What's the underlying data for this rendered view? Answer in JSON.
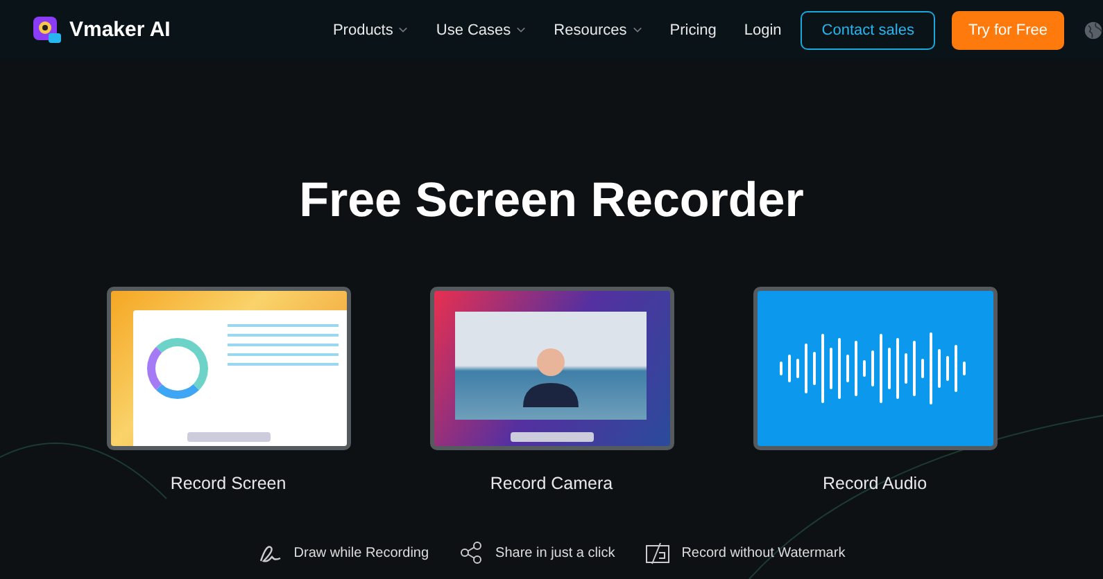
{
  "brand": {
    "name": "Vmaker AI"
  },
  "nav": [
    {
      "label": "Products",
      "has_menu": true
    },
    {
      "label": "Use Cases",
      "has_menu": true
    },
    {
      "label": "Resources",
      "has_menu": true
    },
    {
      "label": "Pricing",
      "has_menu": false
    },
    {
      "label": "Login",
      "has_menu": false
    }
  ],
  "buttons": [
    {
      "label": "Contact sales",
      "kind": "outline"
    },
    {
      "label": "Try for Free",
      "kind": "primary"
    }
  ],
  "heading": "Free Screen Recorder",
  "cards": [
    {
      "kind": "screen",
      "label": "Record Screen"
    },
    {
      "kind": "camera",
      "label": "Record Camera"
    },
    {
      "kind": "audio",
      "label": "Record Audio"
    }
  ],
  "features": [
    {
      "kind": "draw",
      "label": "Draw while Recording"
    },
    {
      "kind": "share",
      "label": "Share in just a click"
    },
    {
      "kind": "watermark",
      "label": "Record without Watermark"
    }
  ]
}
